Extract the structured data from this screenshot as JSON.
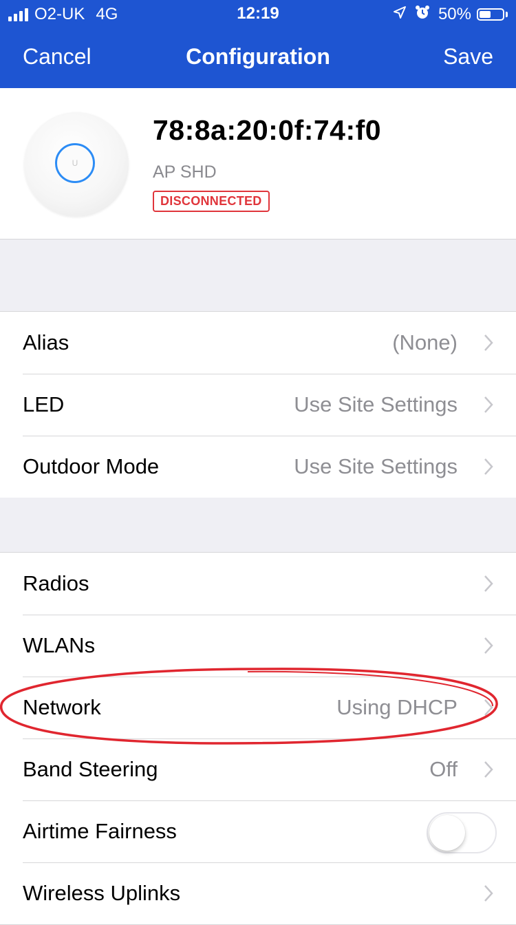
{
  "status_bar": {
    "carrier": "O2-UK",
    "network": "4G",
    "time": "12:19",
    "battery_percent": "50%",
    "battery_level": 0.5,
    "icons": [
      "signal-icon",
      "location-arrow-icon",
      "alarm-icon",
      "battery-icon"
    ]
  },
  "nav": {
    "cancel_label": "Cancel",
    "title": "Configuration",
    "save_label": "Save"
  },
  "device": {
    "mac": "78:8a:20:0f:74:f0",
    "model": "AP SHD",
    "status": "DISCONNECTED",
    "logo_mark": "U",
    "status_color": "#e0353b",
    "led_color": "#2c8cf5"
  },
  "settings_group_1": [
    {
      "label": "Alias",
      "value": "(None)"
    },
    {
      "label": "LED",
      "value": "Use Site Settings"
    },
    {
      "label": "Outdoor Mode",
      "value": "Use Site Settings"
    }
  ],
  "settings_group_2": [
    {
      "label": "Radios",
      "value": ""
    },
    {
      "label": "WLANs",
      "value": ""
    },
    {
      "label": "Network",
      "value": "Using DHCP"
    },
    {
      "label": "Band Steering",
      "value": "Off"
    },
    {
      "label": "Airtime Fairness",
      "toggle_on": false
    },
    {
      "label": "Wireless Uplinks",
      "value": ""
    }
  ],
  "colors": {
    "nav_background": "#1e55d2",
    "annotation_circle": "#e0262f",
    "grouped_background": "#efeff4",
    "secondary_text": "#8e8e93"
  }
}
